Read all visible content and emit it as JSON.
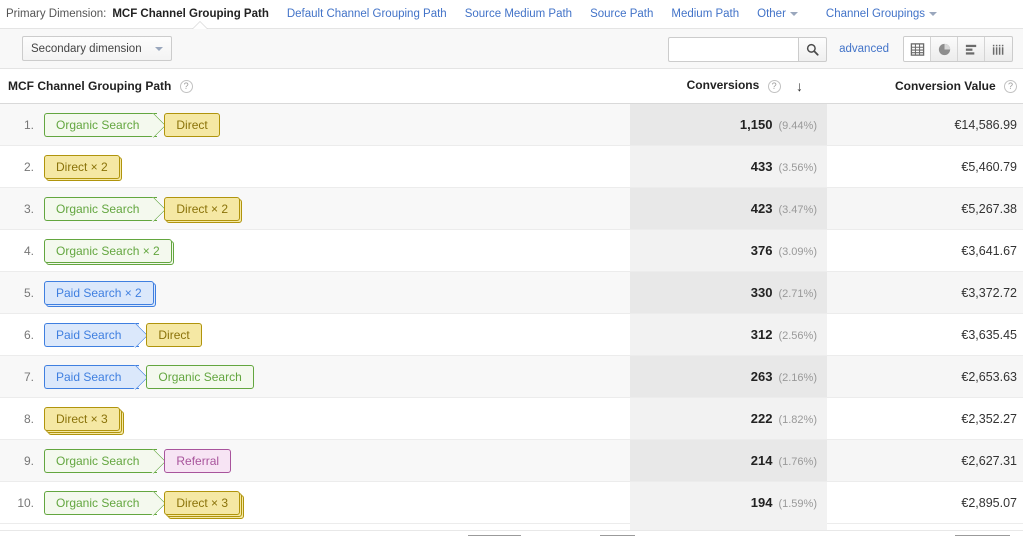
{
  "dimension_bar": {
    "label": "Primary Dimension:",
    "active": "MCF Channel Grouping Path",
    "links": [
      "Default Channel Grouping Path",
      "Source Medium Path",
      "Source Path",
      "Medium Path"
    ],
    "other_label": "Other",
    "channel_groupings_label": "Channel Groupings"
  },
  "toolbar": {
    "secondary_dimension_label": "Secondary dimension",
    "search_value": "",
    "search_placeholder": "",
    "advanced_label": "advanced",
    "views": [
      {
        "name": "table-view",
        "active": true
      },
      {
        "name": "pie-chart-view",
        "active": false
      },
      {
        "name": "bar-chart-view",
        "active": false
      },
      {
        "name": "pivot-view",
        "active": false
      }
    ]
  },
  "table": {
    "headers": {
      "dimension": "MCF Channel Grouping Path",
      "conversions": "Conversions",
      "conversion_value": "Conversion Value",
      "sort_arrow": "↓"
    },
    "rows": [
      {
        "index": "1.",
        "path": [
          {
            "label": "Organic Search",
            "channel": "organic",
            "repeat": 1
          },
          {
            "label": "Direct",
            "channel": "direct",
            "repeat": 1
          }
        ],
        "conversions": "1,150",
        "percent": "(9.44%)",
        "value": "€14,586.99"
      },
      {
        "index": "2.",
        "path": [
          {
            "label": "Direct × 2",
            "channel": "direct",
            "repeat": 2
          }
        ],
        "conversions": "433",
        "percent": "(3.56%)",
        "value": "€5,460.79"
      },
      {
        "index": "3.",
        "path": [
          {
            "label": "Organic Search",
            "channel": "organic",
            "repeat": 1
          },
          {
            "label": "Direct × 2",
            "channel": "direct",
            "repeat": 2
          }
        ],
        "conversions": "423",
        "percent": "(3.47%)",
        "value": "€5,267.38"
      },
      {
        "index": "4.",
        "path": [
          {
            "label": "Organic Search × 2",
            "channel": "organic",
            "repeat": 2
          }
        ],
        "conversions": "376",
        "percent": "(3.09%)",
        "value": "€3,641.67"
      },
      {
        "index": "5.",
        "path": [
          {
            "label": "Paid Search × 2",
            "channel": "paid",
            "repeat": 2
          }
        ],
        "conversions": "330",
        "percent": "(2.71%)",
        "value": "€3,372.72"
      },
      {
        "index": "6.",
        "path": [
          {
            "label": "Paid Search",
            "channel": "paid",
            "repeat": 1
          },
          {
            "label": "Direct",
            "channel": "direct",
            "repeat": 1
          }
        ],
        "conversions": "312",
        "percent": "(2.56%)",
        "value": "€3,635.45"
      },
      {
        "index": "7.",
        "path": [
          {
            "label": "Paid Search",
            "channel": "paid",
            "repeat": 1
          },
          {
            "label": "Organic Search",
            "channel": "organic",
            "repeat": 1
          }
        ],
        "conversions": "263",
        "percent": "(2.16%)",
        "value": "€2,653.63"
      },
      {
        "index": "8.",
        "path": [
          {
            "label": "Direct × 3",
            "channel": "direct",
            "repeat": 3
          }
        ],
        "conversions": "222",
        "percent": "(1.82%)",
        "value": "€2,352.27"
      },
      {
        "index": "9.",
        "path": [
          {
            "label": "Organic Search",
            "channel": "organic",
            "repeat": 1
          },
          {
            "label": "Referral",
            "channel": "referral",
            "repeat": 1
          }
        ],
        "conversions": "214",
        "percent": "(1.76%)",
        "value": "€2,627.31"
      },
      {
        "index": "10.",
        "path": [
          {
            "label": "Organic Search",
            "channel": "organic",
            "repeat": 1
          },
          {
            "label": "Direct × 3",
            "channel": "direct",
            "repeat": 3
          }
        ],
        "conversions": "194",
        "percent": "(1.59%)",
        "value": "€2,895.07"
      }
    ]
  },
  "icons": {
    "search": "search-icon",
    "help": "?",
    "chevron_down": "chevron-down-icon"
  },
  "colors": {
    "link": "#4273c8",
    "organic": "#63a63f",
    "direct": "#b0940c",
    "paid": "#3f7fe0",
    "referral": "#a8549c"
  }
}
